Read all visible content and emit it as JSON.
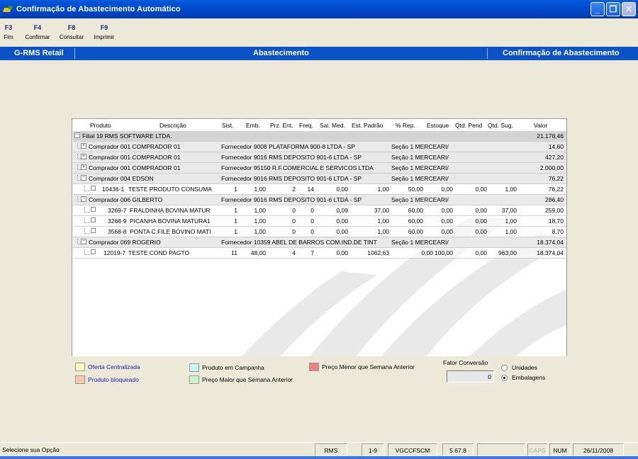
{
  "window": {
    "title": "Confirmação de Abastecimento Automático"
  },
  "toolbar": [
    {
      "key": "F3",
      "label": "Fim"
    },
    {
      "key": "F4",
      "label": "Confirmar"
    },
    {
      "key": "F8",
      "label": "Consultar"
    },
    {
      "key": "F9",
      "label": "Imprimir"
    }
  ],
  "band": {
    "left": "G-RMS Retail",
    "center": "Abastecimento",
    "right": "Confirmação de Abastecimento"
  },
  "grid": {
    "columns": [
      "Produto",
      "Descrição",
      "Sist.",
      "Emb.",
      "Prz. Ent.",
      "Freq.",
      "Sai. Med.",
      "Est. Padrão",
      "% Rep.",
      "Estoque",
      "Qtd. Pend",
      "Qtd. Sug.",
      "Valor"
    ],
    "rows": [
      {
        "type": "filial",
        "label": "Filial 19 RMS SOFTWARE LTDA.",
        "valor": "21.178,46"
      },
      {
        "type": "comprador",
        "toggle": "+",
        "label": "Comprador 001 COMPRADOR 01",
        "fornecedor": "Fornecedor 9008 PLATAFORMA 900-8 LTDA - SP",
        "secao": "Seção 1 MERCEARI/",
        "valor": "14,60"
      },
      {
        "type": "comprador",
        "toggle": "+",
        "label": "Comprador 001 COMPRADOR 01",
        "fornecedor": "Fornecedor 9016 RMS DEPOSITO 901-6 LTDA - SP",
        "secao": "Seção 1 MERCEARI/",
        "valor": "427,20"
      },
      {
        "type": "comprador",
        "toggle": "+",
        "label": "Comprador 001 COMPRADOR 01",
        "fornecedor": "Fornecedor 95150 R.F.COMERCIAL E SERVICOS LTDA",
        "secao": "Seção 1 MERCEARI/",
        "valor": "2.000,00"
      },
      {
        "type": "comprador",
        "toggle": "−",
        "label": "Comprador 004 EDSON",
        "fornecedor": "Fornecedor 9016 RMS DEPOSITO 901-6 LTDA - SP",
        "secao": "Seção 1 MERCEARI/",
        "valor": "76,22"
      },
      {
        "type": "item",
        "codigo": "10436-1",
        "descricao": "TESTE PRODUTO CONSUMA",
        "sist": "1",
        "emb": "1,00",
        "prz": "2",
        "freq": "14",
        "sai": "0,00",
        "est": "1,00",
        "rep": "50,00",
        "estoque": "0,00",
        "pend": "0,00",
        "sug": "1,00",
        "valor": "76,22"
      },
      {
        "type": "comprador",
        "toggle": "−",
        "label": "Comprador 006 GILBERTO",
        "fornecedor": "Fornecedor 9016 RMS DEPOSITO 901-6 LTDA - SP",
        "secao": "Seção 1 MERCEARI/",
        "valor": "286,40"
      },
      {
        "type": "item",
        "codigo": "3269-7",
        "descricao": "FRALDINHA BOVINA MATUR",
        "sist": "1",
        "emb": "1,00",
        "prz": "0",
        "freq": "0",
        "sai": "0,09",
        "est": "37,00",
        "rep": "60,00",
        "estoque": "0,00",
        "pend": "0,00",
        "sug": "37,00",
        "valor": "259,00"
      },
      {
        "type": "item",
        "codigo": "3268-9",
        "descricao": "PICANHA BOVINA MATURA1",
        "sist": "1",
        "emb": "1,00",
        "prz": "0",
        "freq": "0",
        "sai": "0,00",
        "est": "1,00",
        "rep": "60,00",
        "estoque": "0,00",
        "pend": "0,00",
        "sug": "1,00",
        "valor": "18,70"
      },
      {
        "type": "item",
        "codigo": "3568-8",
        "descricao": "PONTA C.FILE BOVINO MATI",
        "sist": "1",
        "emb": "1,00",
        "prz": "0",
        "freq": "0",
        "sai": "0,00",
        "est": "1,00",
        "rep": "60,00",
        "estoque": "0,00",
        "pend": "0,00",
        "sug": "1,00",
        "valor": "8,70"
      },
      {
        "type": "comprador",
        "toggle": "−",
        "label": "Comprador 069 ROGERIO",
        "fornecedor": "Fornecedor 10359 ABEL DE BARROS COM.IND.DE TINT",
        "secao": "Seção 1 MERCEARI/",
        "valor": "18.374,04"
      },
      {
        "type": "item",
        "codigo": "12019-7",
        "descricao": "TESTE COND PAGTO",
        "sist": "11",
        "emb": "48,00",
        "prz": "4",
        "freq": "7",
        "sai": "0,00",
        "est": "1062,63",
        "rep": "0,00",
        "estoque": "100,00",
        "pend": "0,00",
        "sug": "963,00",
        "valor": "18.374,04"
      }
    ]
  },
  "legend": {
    "oferta": "Oferta Centralizada",
    "bloqueado": "Produto bloqueado",
    "campanha": "Produto em Campanha",
    "maior": "Preço Maior que Semana Anterior",
    "menor": "Preço Menor que Semana Anterior",
    "fator_label": "Fator Conversão",
    "fator_value": "0",
    "unidades": "Unidades",
    "embalagens": "Embalagens",
    "colors": {
      "oferta": "#ffffc0",
      "bloqueado": "#f8c8a8",
      "campanha": "#c8f8f8",
      "maior": "#c8f8c0",
      "menor": "#f08080"
    }
  },
  "status": {
    "message": "Selecione sua Opção",
    "system": "RMS",
    "range": "1-9",
    "user": "VGCCFSCM",
    "version": "5.67.8",
    "empty": "",
    "caps": "CAPS",
    "num": "NUM",
    "date": "26/11/2008"
  }
}
